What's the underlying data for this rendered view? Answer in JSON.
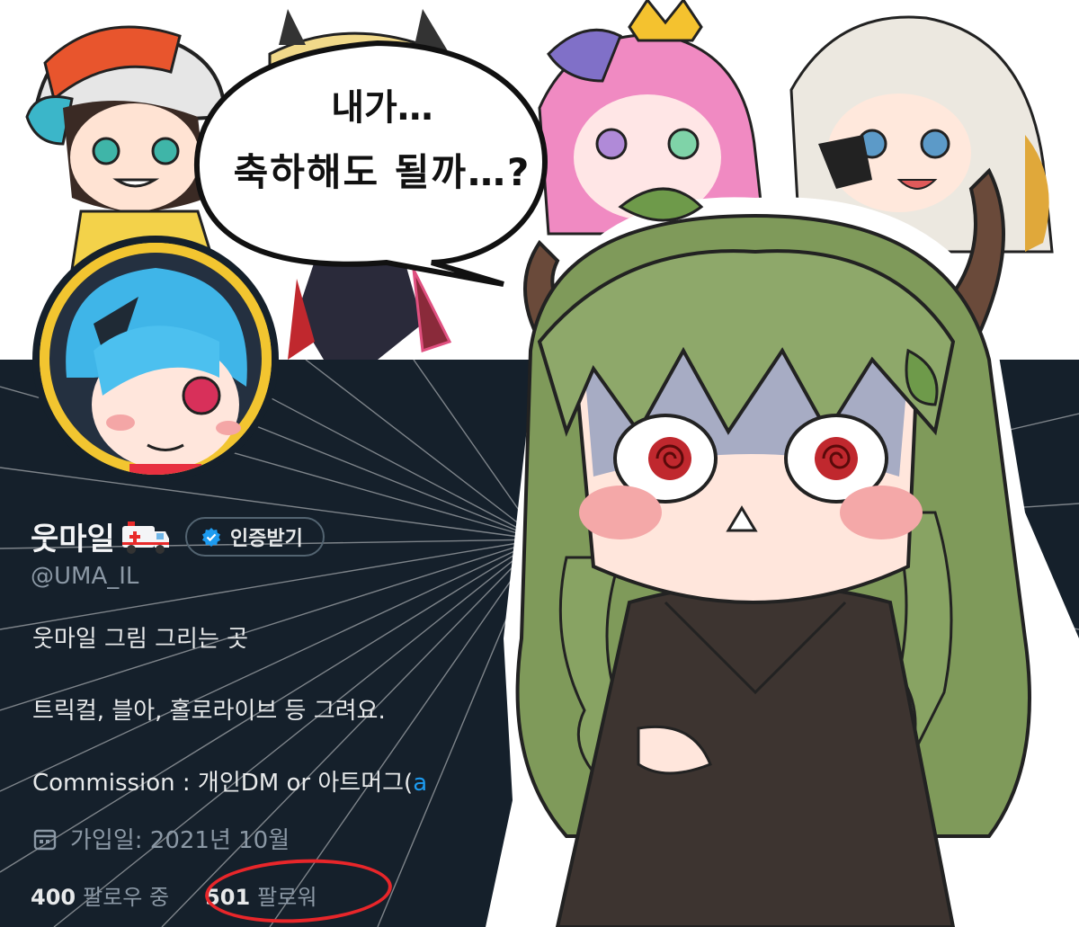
{
  "banner": {
    "characters": [
      "chibi-cap-girl",
      "chibi-blonde-horns",
      "chibi-pink-crown",
      "chibi-white-hair"
    ]
  },
  "speech_bubble": {
    "line1": "내가…",
    "line2": "축하해도 될까…?"
  },
  "profile": {
    "display_name": "웃마일",
    "name_emoji": "ambulance-icon",
    "verify_label": "인증받기",
    "handle": "@UMA_IL",
    "bio": [
      "웃마일 그림 그리는 곳",
      "트릭컬, 블아, 홀로라이브 등 그려요.",
      "Commission : 개인DM or 아트머그("
    ],
    "bio_link": "a",
    "joined": "가입일: 2021년 10월",
    "following_count": "400",
    "following_label": "팔로우 중",
    "followers_count": "501",
    "followers_label": "팔로워"
  },
  "colors": {
    "background": "#15202b",
    "text_primary": "#e7e9ea",
    "text_secondary": "#8b98a5",
    "link": "#1d9bf0",
    "highlight_circle": "#e8262a",
    "hair_green": "#7f9a5a"
  }
}
